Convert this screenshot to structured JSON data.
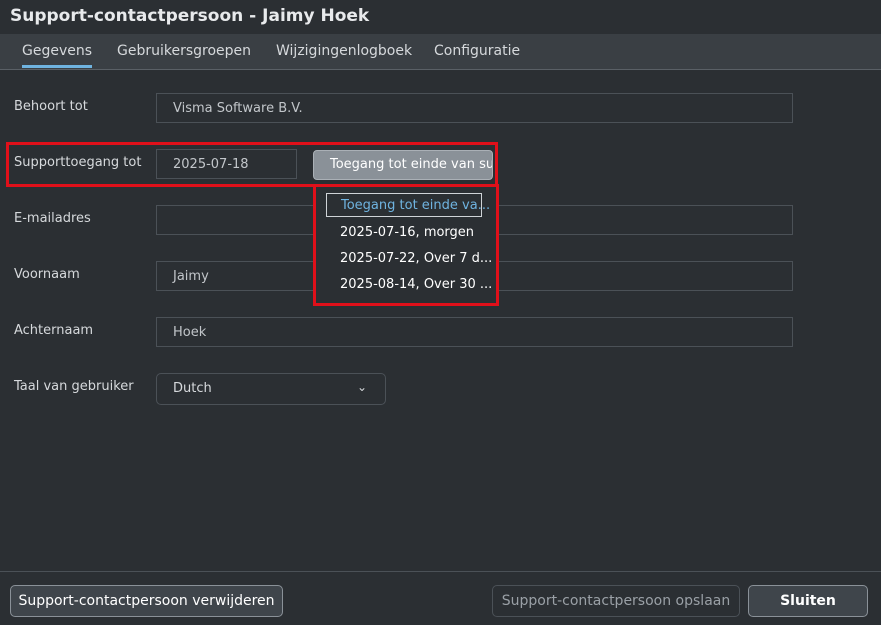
{
  "window": {
    "title": "Support-contactpersoon - Jaimy Hoek"
  },
  "tabs": [
    {
      "label": "Gegevens"
    },
    {
      "label": "Gebruikersgroepen"
    },
    {
      "label": "Wijzigingenlogboek"
    },
    {
      "label": "Configuratie"
    }
  ],
  "form": {
    "belongs_to": {
      "label": "Behoort tot",
      "value": "Visma Software B.V."
    },
    "support_access": {
      "label": "Supporttoegang tot",
      "date": "2025-07-18",
      "button_label": "Toegang tot einde van supp",
      "options": [
        "Toegang tot einde va...",
        "2025-07-16, morgen",
        "2025-07-22, Over 7 d...",
        "2025-08-14, Over 30 ..."
      ]
    },
    "email": {
      "label": "E-mailadres",
      "value": ""
    },
    "first_name": {
      "label": "Voornaam",
      "value": "Jaimy"
    },
    "last_name": {
      "label": "Achternaam",
      "value": "Hoek"
    },
    "language": {
      "label": "Taal van gebruiker",
      "value": "Dutch"
    }
  },
  "footer": {
    "delete_label": "Support-contactpersoon verwijderen",
    "save_label": "Support-contactpersoon opslaan",
    "close_label": "Sluiten"
  },
  "colors": {
    "accent": "#6fb3e0",
    "highlight": "#e0101a"
  },
  "icons": {
    "language_select": "chevron-down-icon"
  }
}
